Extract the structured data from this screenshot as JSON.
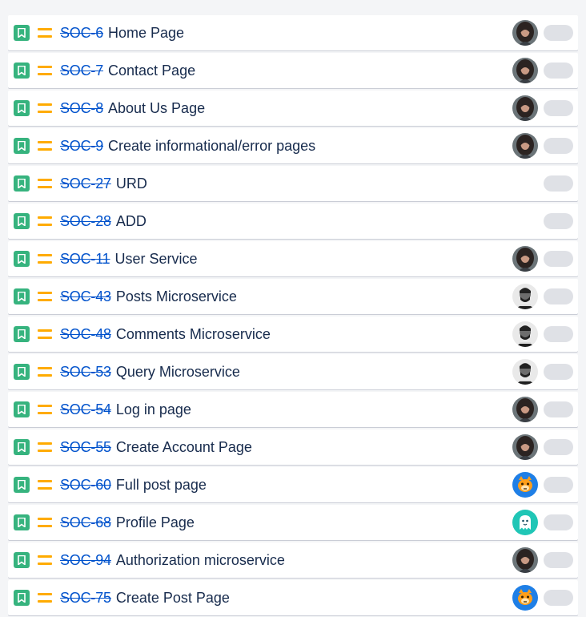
{
  "issues": [
    {
      "key": "SOC-6",
      "summary": "Home Page",
      "type_icon": "story-bookmark-icon",
      "priority_icon": "priority-medium-icon",
      "assignee": "woman"
    },
    {
      "key": "SOC-7",
      "summary": "Contact Page",
      "type_icon": "story-bookmark-icon",
      "priority_icon": "priority-medium-icon",
      "assignee": "woman"
    },
    {
      "key": "SOC-8",
      "summary": "About Us Page",
      "type_icon": "story-bookmark-icon",
      "priority_icon": "priority-medium-icon",
      "assignee": "woman"
    },
    {
      "key": "SOC-9",
      "summary": "Create informational/error pages",
      "type_icon": "story-bookmark-icon",
      "priority_icon": "priority-medium-icon",
      "assignee": "woman"
    },
    {
      "key": "SOC-27",
      "summary": "URD",
      "type_icon": "story-bookmark-icon",
      "priority_icon": "priority-medium-icon",
      "assignee": "none"
    },
    {
      "key": "SOC-28",
      "summary": "ADD",
      "type_icon": "story-bookmark-icon",
      "priority_icon": "priority-medium-icon",
      "assignee": "none"
    },
    {
      "key": "SOC-11",
      "summary": "User Service",
      "type_icon": "story-bookmark-icon",
      "priority_icon": "priority-medium-icon",
      "assignee": "woman"
    },
    {
      "key": "SOC-43",
      "summary": "Posts Microservice",
      "type_icon": "story-bookmark-icon",
      "priority_icon": "priority-medium-icon",
      "assignee": "man"
    },
    {
      "key": "SOC-48",
      "summary": "Comments Microservice",
      "type_icon": "story-bookmark-icon",
      "priority_icon": "priority-medium-icon",
      "assignee": "man"
    },
    {
      "key": "SOC-53",
      "summary": "Query Microservice",
      "type_icon": "story-bookmark-icon",
      "priority_icon": "priority-medium-icon",
      "assignee": "man"
    },
    {
      "key": "SOC-54",
      "summary": "Log in page",
      "type_icon": "story-bookmark-icon",
      "priority_icon": "priority-medium-icon",
      "assignee": "woman"
    },
    {
      "key": "SOC-55",
      "summary": "Create Account Page",
      "type_icon": "story-bookmark-icon",
      "priority_icon": "priority-medium-icon",
      "assignee": "woman"
    },
    {
      "key": "SOC-60",
      "summary": "Full post page",
      "type_icon": "story-bookmark-icon",
      "priority_icon": "priority-medium-icon",
      "assignee": "cat"
    },
    {
      "key": "SOC-68",
      "summary": "Profile Page",
      "type_icon": "story-bookmark-icon",
      "priority_icon": "priority-medium-icon",
      "assignee": "ghost"
    },
    {
      "key": "SOC-94",
      "summary": "Authorization microservice",
      "type_icon": "story-bookmark-icon",
      "priority_icon": "priority-medium-icon",
      "assignee": "woman"
    },
    {
      "key": "SOC-75",
      "summary": "Create Post Page",
      "type_icon": "story-bookmark-icon",
      "priority_icon": "priority-medium-icon",
      "assignee": "cat"
    }
  ],
  "colors": {
    "story": "#36b37e",
    "priority_medium": "#ffab00",
    "issue_key": "#0052cc",
    "summary_text": "#172b4d",
    "estimate_pill": "#dfe1e6"
  }
}
